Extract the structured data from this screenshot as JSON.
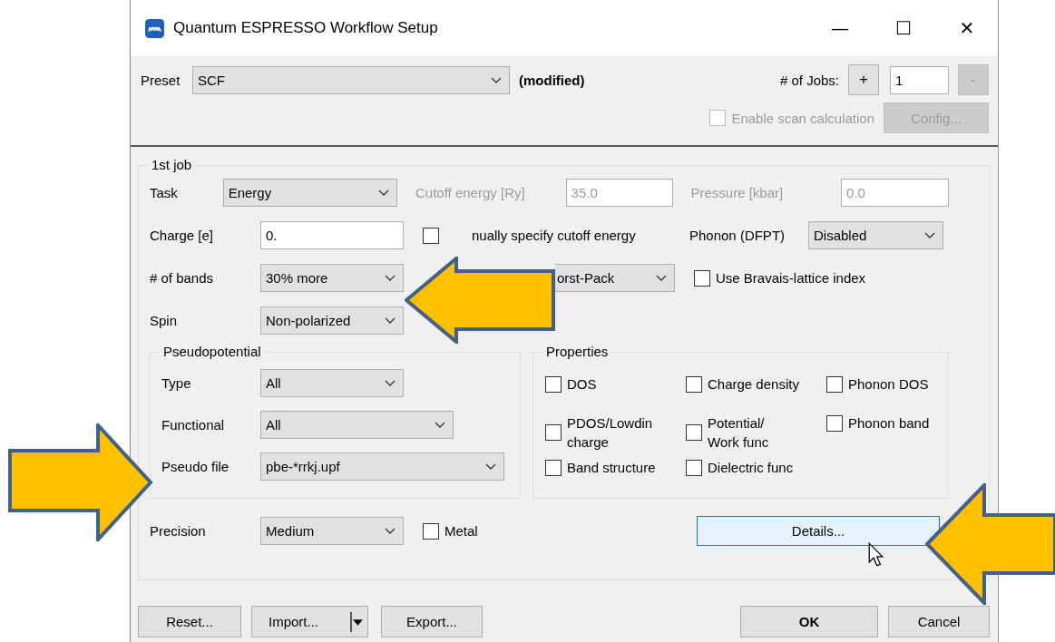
{
  "window": {
    "title": "Quantum ESPRESSO Workflow Setup",
    "buttons": [
      "—",
      "☐",
      "✕"
    ]
  },
  "preset": {
    "label": "Preset",
    "value": "SCF",
    "status": "(modified)"
  },
  "jobs": {
    "label": "# of Jobs:",
    "plus": "+",
    "value": "1",
    "minus": "-",
    "minus_disabled": true
  },
  "scan": {
    "label": "Enable scan calculation",
    "checked": false,
    "disabled": true
  },
  "config_button": {
    "label": "Config...",
    "disabled": true
  },
  "job_group": {
    "title": "1st job",
    "task": {
      "label": "Task",
      "value": "Energy"
    },
    "cutoff": {
      "label": "Cutoff energy [Ry]",
      "value": "35.0",
      "disabled": true
    },
    "pressure": {
      "label": "Pressure [kbar]",
      "value": "0.0",
      "disabled": true
    },
    "charge": {
      "label": "Charge [e]",
      "value": "0."
    },
    "manual_cutoff": {
      "label": "nually specify cutoff energy",
      "checked": false
    },
    "phonon": {
      "label": "Phonon (DFPT)",
      "value": "Disabled"
    },
    "bands": {
      "label": "# of bands",
      "value": "30% more"
    },
    "kpoints": {
      "value": "orst-Pack"
    },
    "bravais": {
      "label": "Use Bravais-lattice index",
      "checked": false
    },
    "spin": {
      "label": "Spin",
      "value": "Non-polarized"
    },
    "pseudo": {
      "title": "Pseudopotential",
      "rows": [
        {
          "label": "Type",
          "value": "All"
        },
        {
          "label": "Functional",
          "value": "All"
        },
        {
          "label": "Pseudo file",
          "value": "pbe-*rrkj.upf"
        }
      ]
    },
    "properties": {
      "title": "Properties",
      "items": [
        {
          "label": "DOS",
          "checked": false
        },
        {
          "label": "Charge density",
          "checked": false
        },
        {
          "label": "Phonon DOS",
          "checked": false
        },
        {
          "label": "PDOS/Lowdin\ncharge",
          "checked": false
        },
        {
          "label": "Potential/\nWork func",
          "checked": false
        },
        {
          "label": "Phonon band",
          "checked": false
        },
        {
          "label": "Band structure",
          "checked": false
        },
        {
          "label": "Dielectric func",
          "checked": false
        }
      ]
    },
    "precision": {
      "label": "Precision",
      "value": "Medium"
    },
    "metal": {
      "label": "Metal",
      "checked": false
    },
    "details_button": {
      "label": "Details...",
      "hovered": true
    }
  },
  "footer": {
    "reset": "Reset...",
    "import": "Import...",
    "export": "Export...",
    "ok": "OK",
    "cancel": "Cancel"
  }
}
